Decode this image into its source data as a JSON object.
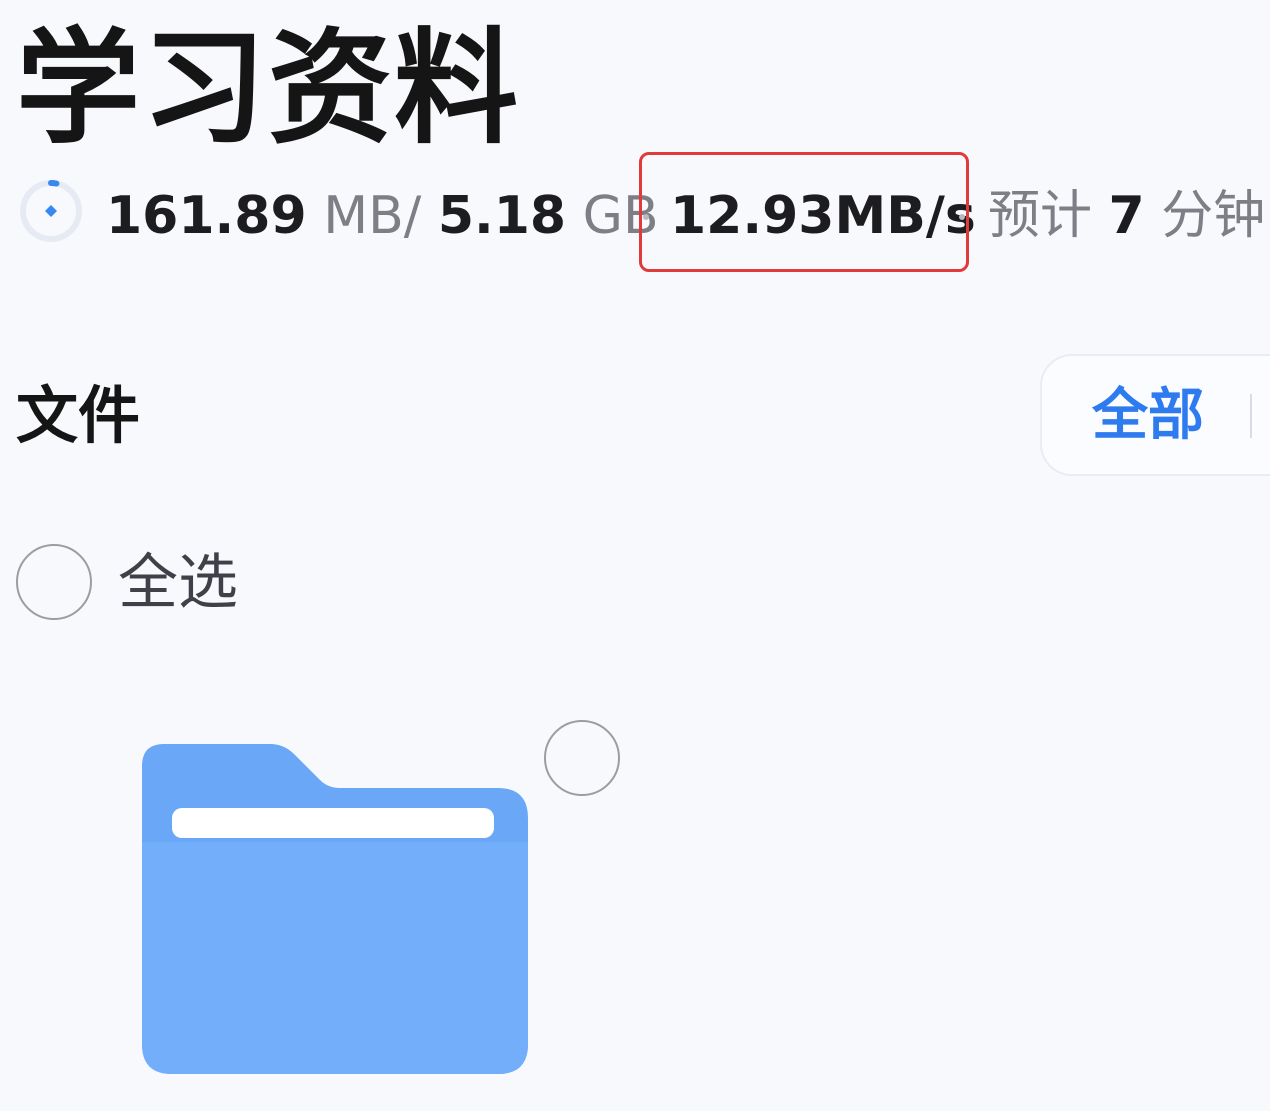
{
  "folder": {
    "title": "学习资料"
  },
  "transfer": {
    "downloaded_value": "161.89",
    "downloaded_unit": "MB",
    "separator": "/",
    "total_value": "5.18",
    "total_unit": "GB",
    "speed": "12.93MB/s",
    "eta_label": "预计",
    "eta_value": "7",
    "eta_unit": "分钟",
    "progress_fraction": 0.031
  },
  "files": {
    "section_title": "文件",
    "filter_label": "全部",
    "select_all_label": "全选"
  },
  "colors": {
    "accent": "#2e7bf0",
    "highlight_box": "#e03a3a",
    "folder": "#6aa8f7"
  },
  "icons": {
    "progress": "download-progress-icon",
    "folder": "folder-icon"
  }
}
